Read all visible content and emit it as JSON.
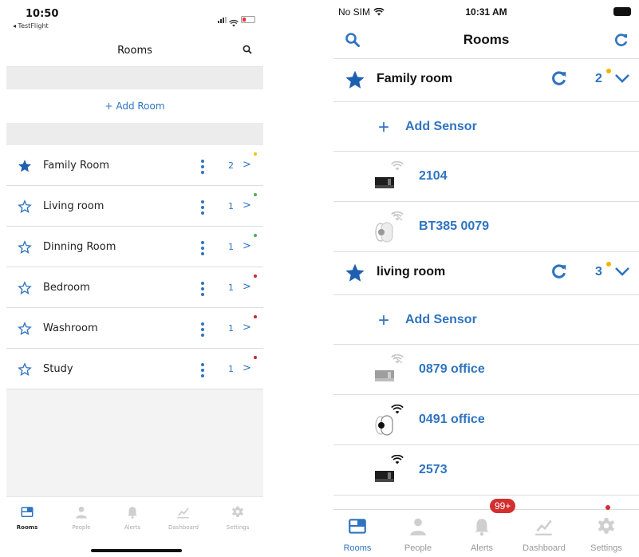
{
  "left": {
    "status": {
      "time": "10:50",
      "back_label": "◂ TestFlight"
    },
    "header": {
      "title": "Rooms"
    },
    "add_room_label": "+ Add Room",
    "rooms": [
      {
        "name": "Family Room",
        "count": "2",
        "favorite": true,
        "dot_color": "#f2c200"
      },
      {
        "name": "Living room",
        "count": "1",
        "favorite": false,
        "dot_color": "#4caf50"
      },
      {
        "name": "Dinning Room",
        "count": "1",
        "favorite": false,
        "dot_color": "#4caf50"
      },
      {
        "name": "Bedroom",
        "count": "1",
        "favorite": false,
        "dot_color": "#c62828"
      },
      {
        "name": "Washroom",
        "count": "1",
        "favorite": false,
        "dot_color": "#c62828"
      },
      {
        "name": "Study",
        "count": "1",
        "favorite": false,
        "dot_color": "#c62828"
      }
    ],
    "chevron": ">",
    "tabs": [
      {
        "label": "Rooms",
        "icon": "rooms-icon",
        "active": true
      },
      {
        "label": "People",
        "icon": "people-icon",
        "active": false
      },
      {
        "label": "Alerts",
        "icon": "bell-icon",
        "active": false
      },
      {
        "label": "Dashboard",
        "icon": "chart-icon",
        "active": false
      },
      {
        "label": "Settings",
        "icon": "gear-icon",
        "active": false
      }
    ]
  },
  "right": {
    "status": {
      "carrier": "No SIM",
      "time": "10:31 AM"
    },
    "header": {
      "title": "Rooms"
    },
    "rooms": [
      {
        "name": "Family room",
        "count": "2",
        "dot_color": "#f2b400",
        "add_sensor_label": "Add Sensor",
        "sensors": [
          {
            "label": "2104",
            "device": "bar-sensor",
            "wifi": "weak"
          },
          {
            "label": "BT385 0079",
            "device": "camera-sensor",
            "wifi": "off"
          }
        ]
      },
      {
        "name": "living room",
        "count": "3",
        "dot_color": "#f2b400",
        "add_sensor_label": "Add Sensor",
        "sensors": [
          {
            "label": "0879 office",
            "device": "bar-sensor",
            "wifi": "off"
          },
          {
            "label": "0491 office",
            "device": "camera-sensor",
            "wifi": "strong"
          },
          {
            "label": "2573",
            "device": "bar-sensor",
            "wifi": "strong"
          }
        ]
      }
    ],
    "tabs": [
      {
        "label": "Rooms",
        "icon": "rooms-icon",
        "active": true
      },
      {
        "label": "People",
        "icon": "people-icon",
        "active": false
      },
      {
        "label": "Alerts",
        "icon": "bell-icon",
        "active": false,
        "badge": "99+"
      },
      {
        "label": "Dashboard",
        "icon": "chart-icon",
        "active": false
      },
      {
        "label": "Settings",
        "icon": "gear-icon",
        "active": false
      }
    ],
    "colors": {
      "accent": "#2f74c0",
      "badge": "#d32f2f"
    }
  }
}
